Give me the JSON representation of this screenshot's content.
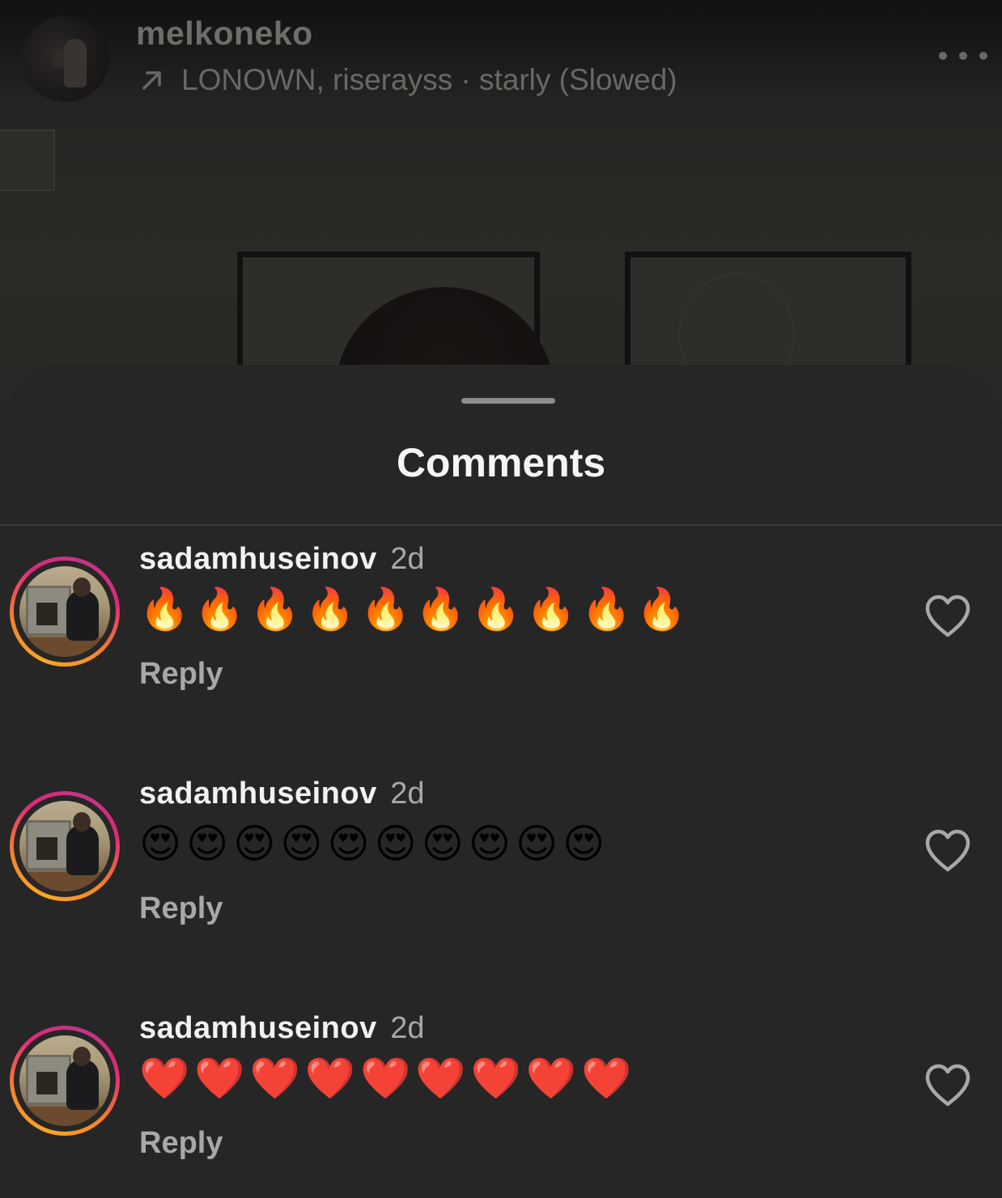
{
  "post": {
    "username": "melkoneko",
    "music": "LONOWN, riserayss · starly (Slowed)"
  },
  "sheet": {
    "title": "Comments"
  },
  "comments": [
    {
      "username": "sadamhuseinov",
      "time": "2d",
      "text": "🔥🔥🔥🔥🔥🔥🔥🔥🔥🔥",
      "reply_label": "Reply"
    },
    {
      "username": "sadamhuseinov",
      "time": "2d",
      "text": "😍😍😍😍😍😍😍😍😍😍",
      "reply_label": "Reply"
    },
    {
      "username": "sadamhuseinov",
      "time": "2d",
      "text": "❤️❤️❤️❤️❤️❤️❤️❤️❤️",
      "reply_label": "Reply"
    }
  ],
  "icons": {
    "music_arrow": "arrow-up-right-icon",
    "more": "more-horizontal-icon",
    "like": "heart-outline-icon"
  },
  "colors": {
    "sheet_background": "#262626",
    "story_ring_start": "#f9a825",
    "story_ring_end": "#c13584",
    "muted_text": "#a8a8a8"
  }
}
